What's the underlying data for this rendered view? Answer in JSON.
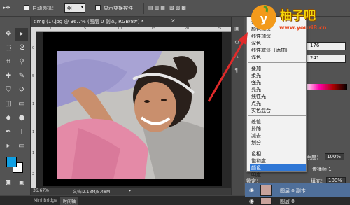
{
  "options_bar": {
    "auto_select_label": "自动选择：",
    "auto_select_value": "组",
    "show_transform_label": "显示变换控件"
  },
  "document": {
    "tab_title": "timg (1).jpg @ 36.7% (图层 0 副本, RGB/8#) *",
    "close_symbol": "×",
    "zoom": "36.67%",
    "doc_size": "文档:2.13M/5.48M"
  },
  "ruler": {
    "h_ticks": [
      "0",
      "5",
      "10",
      "15",
      "20",
      "25"
    ],
    "v_ticks": [
      "0",
      "5",
      "1",
      "1",
      "1",
      "2"
    ]
  },
  "color_panel": {
    "g_value": "176",
    "b_value": "241"
  },
  "blend_menu": {
    "items": [
      "溶解",
      "颜色加深",
      "线性加深",
      "深色",
      "线性减淡（添加）",
      "浅色",
      "叠加",
      "柔光",
      "强光",
      "亮光",
      "线性光",
      "点光",
      "实色混合",
      "差值",
      "排除",
      "减去",
      "划分",
      "色相",
      "饱和度",
      "颜色",
      "明度"
    ],
    "highlight_index": 19
  },
  "layers_panel": {
    "opacity_label": "明度：",
    "opacity_value": "100%",
    "lock_label": "锁定：",
    "fill_label": "填充：",
    "fill_value": "100%",
    "propagate_label": "传播帧 1",
    "layers": [
      {
        "name": "图层 0 副本",
        "selected": true
      },
      {
        "name": "图层 0",
        "selected": false
      }
    ]
  },
  "bottom_tabs": [
    {
      "label": "Mini Bridge",
      "active": false
    },
    {
      "label": "时间轴",
      "active": true
    }
  ],
  "watermark": {
    "title": "柚子吧",
    "url": "www.youzi8.cn",
    "logo_letter": "y"
  },
  "colors": {
    "foreground": "#0f9fe3",
    "background": "#ffffff",
    "menu_highlight": "#2f77d6",
    "panel_bg": "#535353",
    "arrow": "#e02a2a"
  }
}
